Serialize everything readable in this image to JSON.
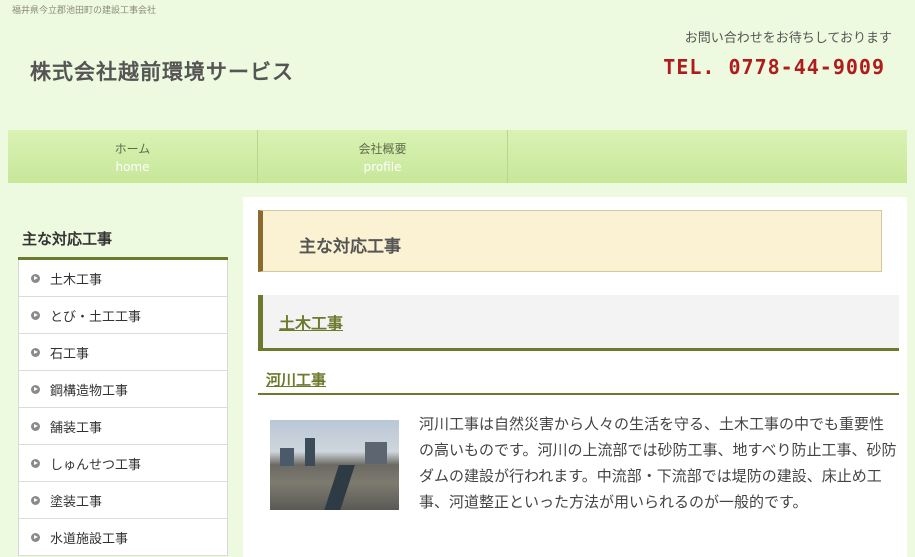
{
  "header": {
    "tagline": "福井県今立郡池田町の建設工事会社",
    "site_title": "株式会社越前環境サービス",
    "contact_message": "お問い合わせをお待ちしております",
    "tel": "TEL. 0778-44-9009"
  },
  "nav": {
    "items": [
      {
        "ja": "ホーム",
        "en": "home"
      },
      {
        "ja": "会社概要",
        "en": "profile"
      }
    ]
  },
  "sidebar": {
    "heading": "主な対応工事",
    "items": [
      "土木工事",
      "とび・土工工事",
      "石工事",
      "鋼構造物工事",
      "舗装工事",
      "しゅんせつ工事",
      "塗装工事",
      "水道施設工事"
    ]
  },
  "main": {
    "heading": "主な対応工事",
    "subheading": "土木工事",
    "section_heading": "河川工事",
    "body": "河川工事は自然災害から人々の生活を守る、土木工事の中でも重要性の高いものです。河川の上流部では砂防工事、地すべり防止工事、砂防ダムの建設が行われます。中流部・下流部では堤防の建設、床止め工事、河道整正といった方法が用いられるのが一般的です。"
  },
  "colors": {
    "background": "#eefadf",
    "tel": "#b01c1c",
    "accent": "#6b7a2c",
    "heading_bg": "#fbf1d3"
  }
}
